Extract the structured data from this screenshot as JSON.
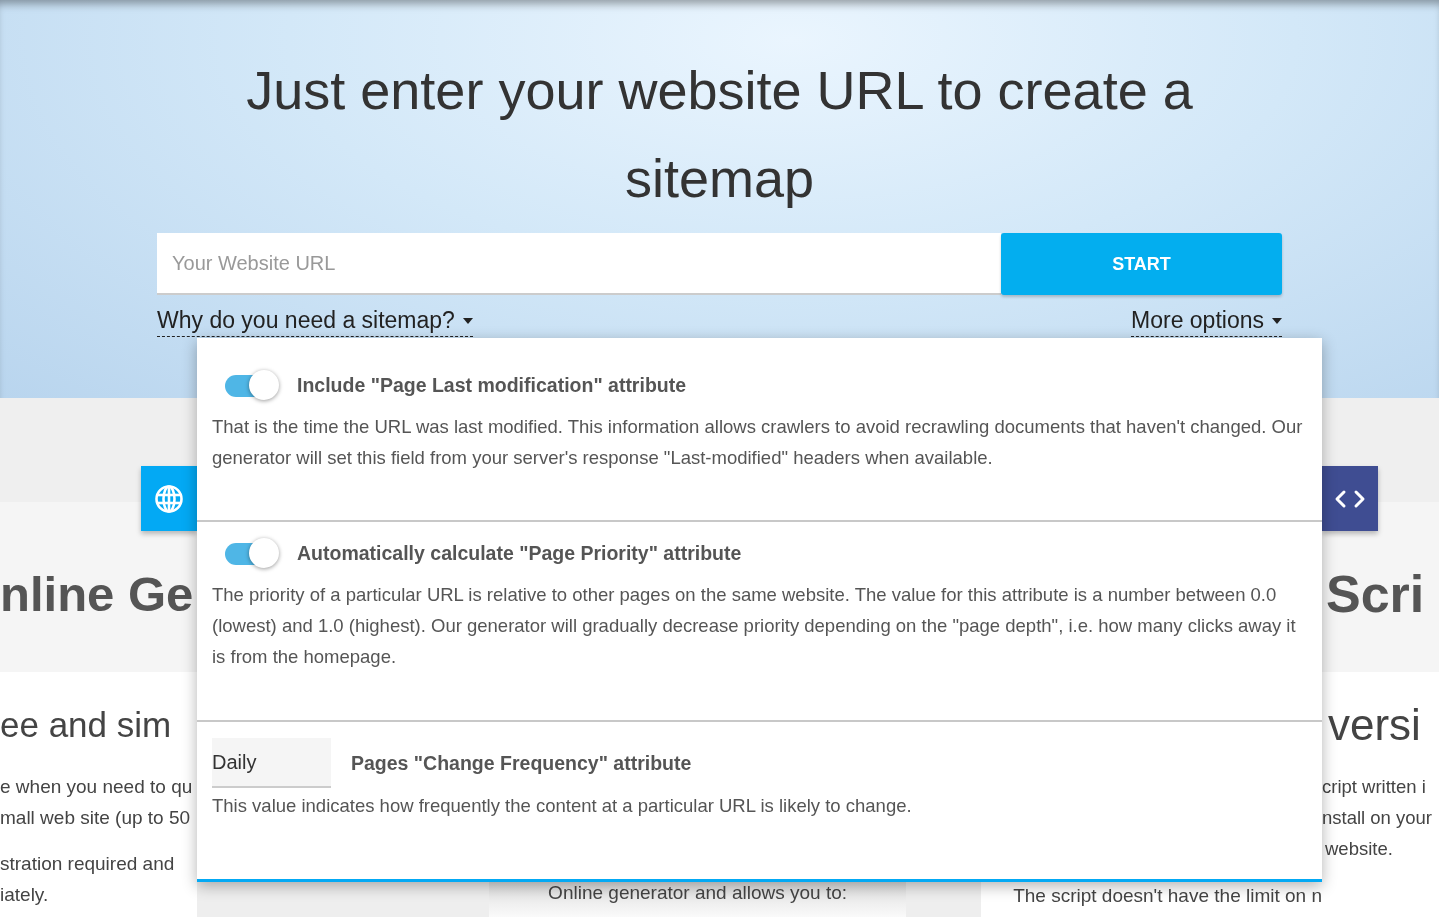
{
  "hero": {
    "title": "Just enter your website URL to create a sitemap",
    "url_field": {
      "placeholder": "Your Website URL"
    },
    "start_button": "START",
    "links": [
      {
        "label": "Why do you need a sitemap?"
      },
      {
        "label": "More options"
      }
    ]
  },
  "options_panel": {
    "options": [
      {
        "kind": "toggle",
        "on": true,
        "title": "Include \"Page Last modification\" attribute",
        "description": "That is the time the URL was last modified. This information allows crawlers to avoid recrawling documents that haven't changed. Our generator will set this field from your server's response \"Last-modified\" headers when available."
      },
      {
        "kind": "toggle",
        "on": true,
        "title": "Automatically calculate \"Page Priority\" attribute",
        "description": "The priority of a particular URL is relative to other pages on the same website. The value for this attribute is a number between 0.0 (lowest) and 1.0 (highest). Our generator will gradually decrease priority depending on the \"page depth\", i.e. how many clicks away it is from the homepage."
      },
      {
        "kind": "select",
        "value": "Daily",
        "title": "Pages \"Change Frequency\" attribute",
        "description": "This value indicates how frequently the content at a particular URL is likely to change."
      }
    ]
  },
  "background_cards": {
    "left": {
      "heading": "nline Ge",
      "subheading": "ee and sim",
      "paragraphs": [
        [
          "e when you need to qu",
          "mall web site (up to 50"
        ],
        [
          "stration required and",
          "iately."
        ]
      ]
    },
    "middle": {
      "text": "Online generator and allows you to:"
    },
    "right": {
      "heading": "Scri",
      "subheading": "versi",
      "lines": [
        "cript written i",
        "nstall on your",
        "website."
      ],
      "bottom_text": "The script doesn't have the limit on n"
    }
  }
}
